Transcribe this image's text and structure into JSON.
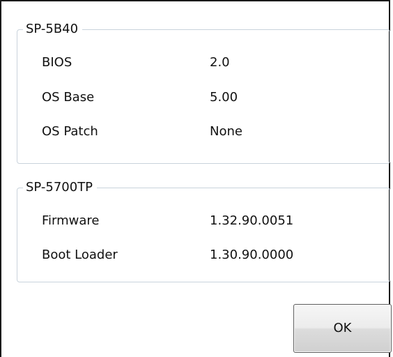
{
  "groups": [
    {
      "title": "SP-5B40",
      "rows": [
        {
          "label": "BIOS",
          "value": "2.0"
        },
        {
          "label": "OS Base",
          "value": "5.00"
        },
        {
          "label": "OS Patch",
          "value": "None"
        }
      ]
    },
    {
      "title": "SP-5700TP",
      "rows": [
        {
          "label": "Firmware",
          "value": "1.32.90.0051"
        },
        {
          "label": "Boot Loader",
          "value": "1.30.90.0000"
        }
      ]
    }
  ],
  "buttons": {
    "ok_label": "OK"
  }
}
